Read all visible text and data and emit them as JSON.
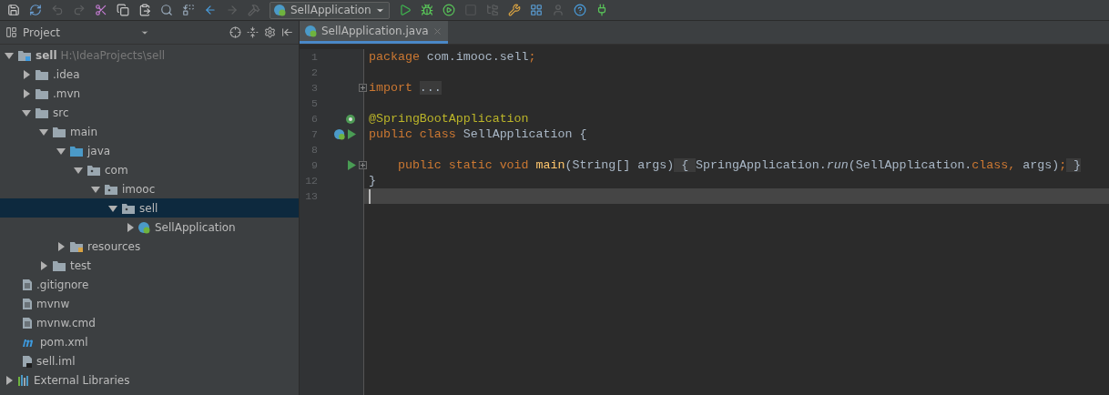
{
  "toolbar": [
    {
      "kind": "save",
      "disabled": false
    },
    {
      "kind": "sync",
      "disabled": false
    },
    {
      "kind": "undo",
      "disabled": true
    },
    {
      "kind": "redo",
      "disabled": true
    },
    {
      "kind": "cut",
      "disabled": false
    },
    {
      "kind": "copy",
      "disabled": false
    },
    {
      "kind": "paste",
      "disabled": false
    },
    {
      "kind": "find",
      "disabled": false
    },
    {
      "kind": "replace",
      "disabled": false
    },
    {
      "kind": "back",
      "disabled": false
    },
    {
      "kind": "forward",
      "disabled": true
    },
    {
      "kind": "build",
      "disabled": true
    },
    {
      "kind": "run_config",
      "label": "SellApplication"
    },
    {
      "kind": "run",
      "disabled": false
    },
    {
      "kind": "debug",
      "disabled": false
    },
    {
      "kind": "coverage",
      "disabled": false
    },
    {
      "kind": "stop",
      "disabled": true
    },
    {
      "kind": "structure",
      "disabled": true
    },
    {
      "kind": "settings",
      "disabled": false
    },
    {
      "kind": "project_structure",
      "disabled": false
    },
    {
      "kind": "sdk",
      "disabled": true
    },
    {
      "kind": "help",
      "disabled": false
    },
    {
      "kind": "plugin",
      "disabled": false
    }
  ],
  "project_panel": {
    "title": "Project",
    "tree": [
      {
        "label": "sell",
        "path": "H:\\IdeaProjects\\sell",
        "kind": "project",
        "expanded": true,
        "selected": false,
        "children": [
          {
            "label": ".idea",
            "kind": "folder",
            "expanded": false,
            "selected": false
          },
          {
            "label": ".mvn",
            "kind": "folder",
            "expanded": false,
            "selected": false
          },
          {
            "label": "src",
            "kind": "folder",
            "expanded": true,
            "selected": false,
            "children": [
              {
                "label": "main",
                "kind": "folder",
                "expanded": true,
                "selected": false,
                "children": [
                  {
                    "label": "java",
                    "kind": "source",
                    "expanded": true,
                    "selected": false,
                    "children": [
                      {
                        "label": "com",
                        "kind": "package",
                        "expanded": true,
                        "selected": false,
                        "children": [
                          {
                            "label": "imooc",
                            "kind": "package",
                            "expanded": true,
                            "selected": false,
                            "children": [
                              {
                                "label": "sell",
                                "kind": "package",
                                "expanded": true,
                                "selected": true,
                                "children": [
                                  {
                                    "label": "SellApplication",
                                    "kind": "spring",
                                    "expanded": false,
                                    "selected": false
                                  }
                                ]
                              }
                            ]
                          }
                        ]
                      }
                    ]
                  },
                  {
                    "label": "resources",
                    "kind": "resources",
                    "expanded": false,
                    "selected": false
                  }
                ]
              },
              {
                "label": "test",
                "kind": "folder",
                "expanded": false,
                "selected": false
              }
            ]
          },
          {
            "label": ".gitignore",
            "kind": "file",
            "selected": false
          },
          {
            "label": "mvnw",
            "kind": "file",
            "selected": false
          },
          {
            "label": "mvnw.cmd",
            "kind": "file",
            "selected": false
          },
          {
            "label": "pom.xml",
            "kind": "maven",
            "selected": false
          },
          {
            "label": "sell.iml",
            "kind": "module",
            "selected": false
          }
        ]
      },
      {
        "label": "External Libraries",
        "kind": "libraries",
        "expanded": false,
        "selected": false
      }
    ]
  },
  "editor": {
    "tabs": [
      {
        "label": "SellApplication.java",
        "selected": true
      }
    ],
    "lines": [
      {
        "number": "1",
        "current": false,
        "tokens": [
          {
            "kind": "keyword",
            "text": "package"
          },
          {
            "kind": "plain",
            "text": " com.imooc.sell"
          },
          {
            "kind": "keyword",
            "text": ";"
          }
        ]
      },
      {
        "number": "2",
        "current": false
      },
      {
        "number": "3",
        "current": false,
        "fold": true,
        "tokens": [
          {
            "kind": "keyword",
            "text": "import "
          },
          {
            "kind": "folded",
            "text": "..."
          }
        ]
      },
      {
        "number": "5",
        "current": false
      },
      {
        "number": "6",
        "current": false,
        "gutter": [
          {
            "kind": "bean"
          }
        ],
        "tokens": [
          {
            "kind": "annotation",
            "text": "@SpringBootApplication"
          }
        ]
      },
      {
        "number": "7",
        "current": false,
        "gutter": [
          {
            "kind": "spring"
          },
          {
            "kind": "run"
          }
        ],
        "tokens": [
          {
            "kind": "keyword",
            "text": "public class"
          },
          {
            "kind": "plain",
            "text": " SellApplication {"
          }
        ]
      },
      {
        "number": "8",
        "current": false
      },
      {
        "number": "9",
        "current": false,
        "fold": true,
        "gutter": [
          {
            "kind": "run"
          }
        ],
        "tokens": [
          {
            "kind": "keyword",
            "text": "    public static void "
          },
          {
            "kind": "method",
            "text": "main"
          },
          {
            "kind": "plain",
            "text": "(String[] args)"
          },
          {
            "kind": "folded",
            "text": " { "
          },
          {
            "kind": "plain",
            "text": "SpringApplication."
          },
          {
            "kind": "italic",
            "text": "run"
          },
          {
            "kind": "plain",
            "text": "(SellApplication."
          },
          {
            "kind": "keyword",
            "text": "class"
          },
          {
            "kind": "keyword",
            "text": ","
          },
          {
            "kind": "plain",
            "text": " args)"
          },
          {
            "kind": "keyword",
            "text": ";"
          },
          {
            "kind": "folded",
            "text": " }"
          }
        ]
      },
      {
        "number": "12",
        "current": false,
        "tokens": [
          {
            "kind": "plain",
            "text": "}"
          }
        ]
      },
      {
        "number": "13",
        "current": true
      }
    ]
  }
}
